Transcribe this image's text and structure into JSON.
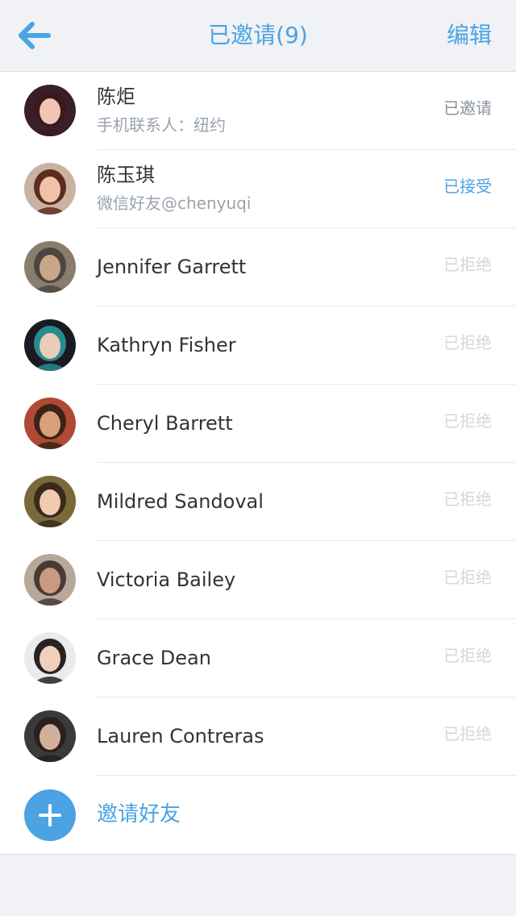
{
  "nav": {
    "back_icon": "arrow-left-icon",
    "title": "已邀请(9)",
    "edit_label": "编辑"
  },
  "accent_color": "#4ba3e3",
  "contacts": [
    {
      "name": "陈炬",
      "subtitle": "手机联系人：纽约",
      "status": "已邀请",
      "status_type": "invited",
      "bg": "#3a1f2a",
      "skin": "#f0c5b6",
      "hair": "#3b1a1e"
    },
    {
      "name": "陈玉琪",
      "subtitle": "微信好友@chenyuqi",
      "status": "已接受",
      "status_type": "accepted",
      "bg": "#c9b3a0",
      "skin": "#f2c1a9",
      "hair": "#5a2d1e"
    },
    {
      "name": "Jennifer Garrett",
      "status": "已拒绝",
      "status_type": "declined",
      "bg": "#8a7d6e",
      "skin": "#c9a689",
      "hair": "#4d4540"
    },
    {
      "name": "Kathryn Fisher",
      "status": "已拒绝",
      "status_type": "declined",
      "bg": "#1a1a22",
      "skin": "#e9cdb9",
      "hair": "#2a8a92"
    },
    {
      "name": "Cheryl Barrett",
      "status": "已拒绝",
      "status_type": "declined",
      "bg": "#b04a35",
      "skin": "#d9a07a",
      "hair": "#3a2418"
    },
    {
      "name": "Mildred Sandoval",
      "status": "已拒绝",
      "status_type": "declined",
      "bg": "#7a6a3a",
      "skin": "#f0cbb0",
      "hair": "#3a2a1c"
    },
    {
      "name": "Victoria Bailey",
      "status": "已拒绝",
      "status_type": "declined",
      "bg": "#b8a89a",
      "skin": "#c99a80",
      "hair": "#4a3a35"
    },
    {
      "name": "Grace Dean",
      "status": "已拒绝",
      "status_type": "declined",
      "bg": "#e8ecef",
      "skin": "#f0d0bc",
      "hair": "#2a2220"
    },
    {
      "name": "Lauren Contreras",
      "status": "已拒绝",
      "status_type": "declined",
      "bg": "#3a3a38",
      "skin": "#d2b09a",
      "hair": "#2a2020"
    }
  ],
  "invite": {
    "icon": "plus-icon",
    "label": "邀请好友"
  }
}
